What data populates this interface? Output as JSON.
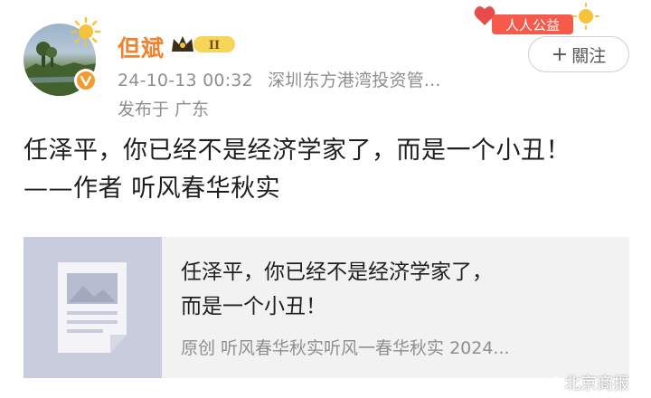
{
  "post": {
    "author": "但斌",
    "vip_level": "II",
    "timestamp": "24-10-13 00:32",
    "device": "深圳东方港湾投资管...",
    "location": "发布于 广东",
    "follow_label": "關注",
    "follow_plus": "+",
    "badge_text": "人人公益",
    "text_line1": "任泽平，你已经不是经济学家了，而是一个小丑！",
    "text_line2": "——作者 听风春华秋实"
  },
  "card": {
    "title_line1": "任泽平，你已经不是经济学家了，",
    "title_line2": "而是一个小丑！",
    "source": "原创  听风春华秋实听风一春华秋实 2024..."
  },
  "watermark": "北京商报",
  "colors": {
    "name": "#f0832e",
    "muted": "#8e8e8e",
    "card_bg": "#f2f2f2",
    "thumb_bg": "#c9ccdc"
  }
}
